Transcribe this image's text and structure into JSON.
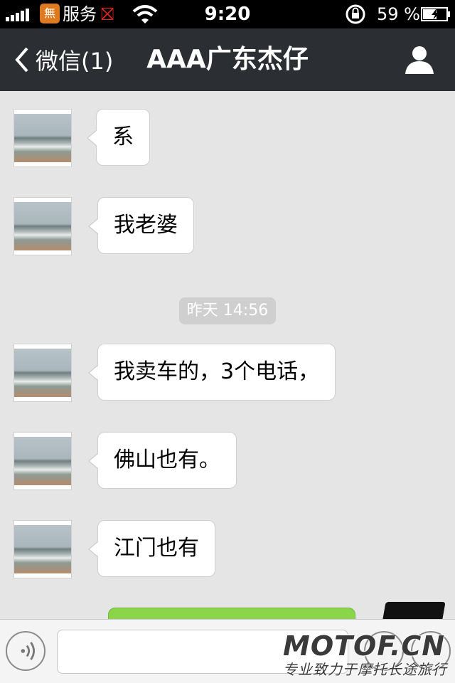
{
  "status_bar": {
    "carrier_badge": "無",
    "carrier": "服务",
    "carrier_alert": "⛝",
    "time": "9:20",
    "battery_percent": "59 %"
  },
  "nav": {
    "back_label": "微信(1)",
    "title": "AAA广东杰仔"
  },
  "messages": [
    {
      "text": "系"
    },
    {
      "text": "我老婆"
    },
    {
      "text": "我卖车的，3个电话，"
    },
    {
      "text": "佛山也有。"
    },
    {
      "text": "江门也有"
    }
  ],
  "timestamp": "昨天 14:56",
  "input": {
    "placeholder": ""
  },
  "watermark": {
    "title": "MOTOF.CN",
    "subtitle": "专业致力于摩托长途旅行"
  },
  "colors": {
    "nav_background": "#2b2f33",
    "chat_background": "#e5e5e5",
    "outgoing_bubble": "#8bd54a"
  }
}
